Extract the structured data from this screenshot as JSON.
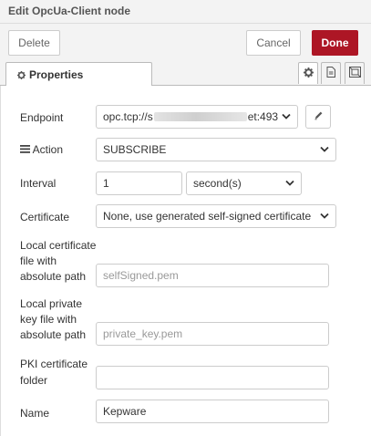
{
  "header": {
    "title": "Edit OpcUa-Client node"
  },
  "toolbar": {
    "delete_label": "Delete",
    "cancel_label": "Cancel",
    "done_label": "Done"
  },
  "tabs": {
    "properties_label": "Properties",
    "icons": [
      "gear-icon",
      "description-icon",
      "appearance-icon"
    ]
  },
  "form": {
    "endpoint": {
      "label": "Endpoint",
      "value_prefix": "opc.tcp://s",
      "value_suffix": "et:493"
    },
    "action": {
      "label": "Action",
      "value": "SUBSCRIBE"
    },
    "interval": {
      "label": "Interval",
      "value": "1",
      "unit": "second(s)"
    },
    "certificate": {
      "label": "Certificate",
      "value": "None, use generated self-signed certificate"
    },
    "local_cert": {
      "label_line1": "Local certificate",
      "label_line2": "file with",
      "label_line3": "absolute path",
      "placeholder": "selfSigned.pem"
    },
    "local_key": {
      "label_line1": "Local private",
      "label_line2": "key file with",
      "label_line3": "absolute path",
      "placeholder": "private_key.pem"
    },
    "pki_folder": {
      "label_line1": "PKI certificate",
      "label_line2": "folder",
      "value": ""
    },
    "name": {
      "label": "Name",
      "value": "Kepware"
    }
  },
  "colors": {
    "done_bg": "#ad1625",
    "border": "#cccccc",
    "tray_bg": "#f3f3f3"
  }
}
